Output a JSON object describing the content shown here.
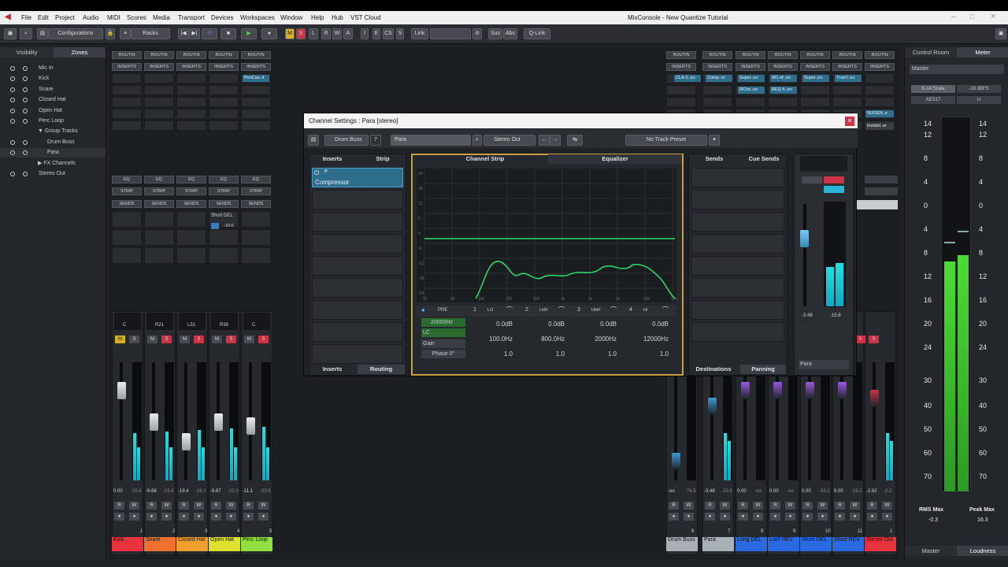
{
  "title_bar": {
    "window_title": "MixConsole - New Quantize Tutorial"
  },
  "menu": [
    "File",
    "Edit",
    "Project",
    "Audio",
    "MIDI",
    "Scores",
    "Media",
    "Transport",
    "Devices",
    "Workspaces",
    "Window",
    "Help",
    "Hub",
    "VST Cloud"
  ],
  "toolbar": {
    "configurations": "Configurations",
    "racks": "Racks",
    "mode_buttons": [
      "M",
      "S",
      "L",
      "R",
      "W",
      "A"
    ],
    "view_buttons": [
      "I",
      "E",
      "CS",
      "S"
    ],
    "link": "Link",
    "sus": "Sus",
    "abs": "Abs",
    "qlink": "Q-Link"
  },
  "left_panel": {
    "tabs": [
      "Visibility",
      "Zones"
    ],
    "tracks": [
      {
        "name": "Mic In",
        "indent": 0
      },
      {
        "name": "Kick",
        "indent": 0
      },
      {
        "name": "Snare",
        "indent": 0
      },
      {
        "name": "Closed Hat",
        "indent": 0
      },
      {
        "name": "Open Hat",
        "indent": 0
      },
      {
        "name": "Perc Loop",
        "indent": 0
      },
      {
        "name": "Group Tracks",
        "indent": 1
      },
      {
        "name": "Drum Buss",
        "indent": 2
      },
      {
        "name": "Para",
        "indent": 2
      },
      {
        "name": "FX Channels",
        "indent": 1
      },
      {
        "name": "Stereo Out",
        "indent": 0
      }
    ]
  },
  "rack_labels": {
    "routing": "ROUTIN",
    "inserts": "INSERTS",
    "eq": "EQ",
    "strip": "STRIP",
    "sends": "SENDS"
  },
  "rack_plugins": {
    "para": "PonCas..it",
    "drum_buss": "CLA-2..eo",
    "para_r": "Comp..or",
    "long_del": "Super..eo",
    "long_del2": "RChe..eo",
    "lonf_rev": "IR1 ef..eo",
    "lonf_rev2": "REQ 4..eo",
    "short_rev": "Super..eo",
    "stereo_out": "TrueV..eo",
    "master_1": "NUGEN..e",
    "master_2": "Invisibl..er",
    "send_name": "Short DEL",
    "send_val": "-19.0"
  },
  "dialog": {
    "title": "Channel Settings : Para [stereo]",
    "prev_channel": "Drum Buss",
    "channel_index": "7",
    "channel_name": "Para",
    "next_channel": "Stereo Out",
    "preset": "No Track Preset",
    "inserts_tab": "Inserts",
    "strip_tab": "Strip",
    "insert_slot_label": "Compressor",
    "insert_slot_top": "e",
    "channel_strip_tab": "Channel Strip",
    "equalizer_tab": "Equalizer",
    "sends_tab": "Sends",
    "cue_sends_tab": "Cue Sends",
    "bottom_tabs": [
      "Inserts",
      "Routing",
      "Destinations",
      "Panning"
    ],
    "eq_y_labels": [
      "24",
      "18",
      "12",
      "6",
      "0",
      "-6",
      "-12",
      "-18",
      "-24"
    ],
    "eq_x_labels": [
      "20",
      "50",
      "100",
      "200",
      "500",
      "1k",
      "2k",
      "5k",
      "10k",
      "20k"
    ],
    "pre_label": "PRE",
    "bands": [
      {
        "num": "1",
        "type": "LO",
        "gain": "0.0dB",
        "freq": "100.0Hz",
        "q": "1.0"
      },
      {
        "num": "2",
        "type": "LMF",
        "gain": "0.0dB",
        "freq": "800.0Hz",
        "q": "1.0"
      },
      {
        "num": "3",
        "type": "HMF",
        "gain": "0.0dB",
        "freq": "2000Hz",
        "q": "1.0"
      },
      {
        "num": "4",
        "type": "HI",
        "gain": "0.0dB",
        "freq": "12000Hz",
        "q": "1.0"
      }
    ],
    "hc_value": "20000Hz",
    "lc_label": "LC",
    "gain_label": "Gain",
    "phase_label": "Phase 0°",
    "fader_value": "-3.48",
    "fader_right": "-15.6",
    "routing_target": "Para"
  },
  "left_strips": [
    {
      "pan": "C",
      "vol": "0.00",
      "peak": "-15.6",
      "name": "Kick",
      "num": "1",
      "color": "#e8323c"
    },
    {
      "pan": "R21",
      "vol": "-9.68",
      "peak": "-15.6",
      "name": "Snare",
      "num": "2",
      "color": "#f07030"
    },
    {
      "pan": "L31",
      "vol": "-19.4",
      "peak": "-26.1",
      "name": "Closed Hat",
      "num": "3",
      "color": "#f0a030"
    },
    {
      "pan": "R38",
      "vol": "-9.87",
      "peak": "-22.0",
      "name": "Open Hat",
      "num": "4",
      "color": "#e0e030"
    },
    {
      "pan": "C",
      "vol": "-11.1",
      "peak": "-23.6",
      "name": "Perc Loop",
      "num": "5",
      "color": "#90e040"
    }
  ],
  "right_strips": [
    {
      "name": "Drum Buss",
      "num": "6",
      "vol": "-oo",
      "peak": "-76.5",
      "color": "#aab0b8"
    },
    {
      "name": "Para",
      "num": "7",
      "vol": "-3.48",
      "peak": "-15.6",
      "color": "#aab0b8"
    },
    {
      "name": "Long DEL",
      "num": "8",
      "vol": "0.00",
      "peak": "-oo",
      "color": "#2a6ae0"
    },
    {
      "name": "Lonf REV",
      "num": "9",
      "vol": "0.00",
      "peak": "-oo",
      "color": "#2a6ae0"
    },
    {
      "name": "Short DEL",
      "num": "10",
      "vol": "0.00",
      "peak": "-43.2",
      "color": "#2a6ae0"
    },
    {
      "name": "Short REV",
      "num": "11",
      "vol": "0.00",
      "peak": "-29.2",
      "color": "#2a6ae0"
    },
    {
      "name": "Stereo Out",
      "num": "1",
      "vol": "-2.62",
      "peak": "-2.2",
      "color": "#e8323c"
    }
  ],
  "right_panel": {
    "tabs": [
      "Control Room",
      "Meter"
    ],
    "master": "Master",
    "scale_btn1": "K-14 Scale",
    "scale_btn2": "-18 dBFS",
    "scale_btn3": "AES17",
    "scale_btn4": "I-I",
    "scale_left": [
      "14",
      "12",
      "8",
      "4",
      "0",
      "4",
      "8",
      "12",
      "16",
      "20",
      "24",
      "30",
      "40",
      "50",
      "60",
      "70"
    ],
    "scale_right": [
      "14",
      "12",
      "8",
      "4",
      "0",
      "4",
      "8",
      "12",
      "16",
      "20",
      "24",
      "30",
      "40",
      "50",
      "60",
      "70"
    ],
    "rms_label": "RMS Max",
    "rms_val": "-0.3",
    "peak_label": "Peak Max",
    "peak_val": "16.3",
    "meter_level": 0.42,
    "bottom_tabs": [
      "Master",
      "Loudness"
    ]
  }
}
